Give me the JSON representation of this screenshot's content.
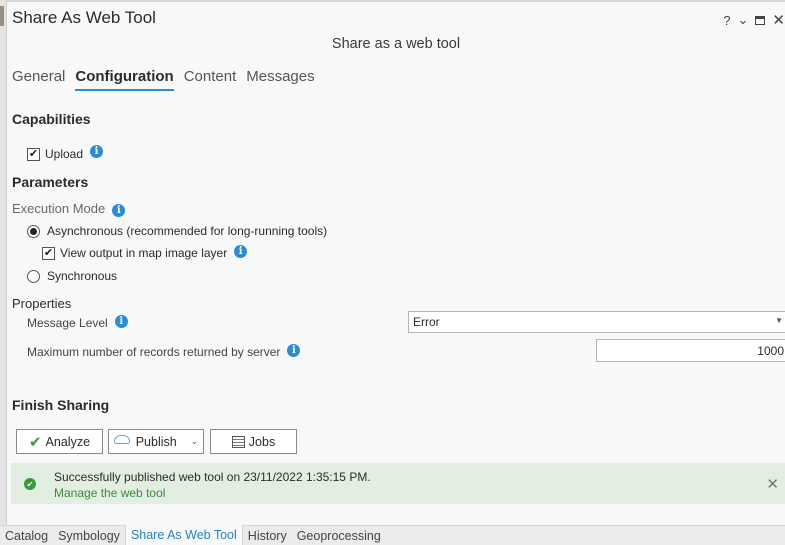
{
  "window": {
    "title": "Share As Web Tool",
    "subtitle": "Share as a web tool",
    "controls": {
      "help": "?",
      "menu": "⌄",
      "close": "✕"
    }
  },
  "tabs": [
    {
      "label": "General",
      "active": false
    },
    {
      "label": "Configuration",
      "active": true
    },
    {
      "label": "Content",
      "active": false
    },
    {
      "label": "Messages",
      "active": false
    }
  ],
  "capabilities": {
    "heading": "Capabilities",
    "upload": {
      "label": "Upload",
      "checked": true
    }
  },
  "parameters": {
    "heading": "Parameters",
    "execution_mode": {
      "label": "Execution Mode",
      "asynchronous": {
        "label": "Asynchronous (recommended for long-running tools)",
        "selected": true
      },
      "view_output": {
        "label": "View output in map image layer",
        "checked": true
      },
      "synchronous": {
        "label": "Synchronous",
        "selected": false
      }
    }
  },
  "properties": {
    "heading": "Properties",
    "message_level": {
      "label": "Message Level",
      "value": "Error"
    },
    "max_records": {
      "label": "Maximum number of records returned by server",
      "value": "1000"
    }
  },
  "finish_sharing": {
    "heading": "Finish Sharing",
    "analyze_label": "Analyze",
    "publish_label": "Publish",
    "jobs_label": "Jobs"
  },
  "banner": {
    "message": "Successfully published web tool on 23/11/2022 1:35:15 PM.",
    "link": "Manage the web tool",
    "close": "✕"
  },
  "bottom_tabs": [
    {
      "label": "Catalog",
      "active": false
    },
    {
      "label": "Symbology",
      "active": false
    },
    {
      "label": "Share As Web Tool",
      "active": true
    },
    {
      "label": "History",
      "active": false
    },
    {
      "label": "Geoprocessing",
      "active": false
    }
  ],
  "colors": {
    "accent": "#2a8bd8",
    "success": "#3a9a3a",
    "banner_bg": "#e2eee2"
  }
}
